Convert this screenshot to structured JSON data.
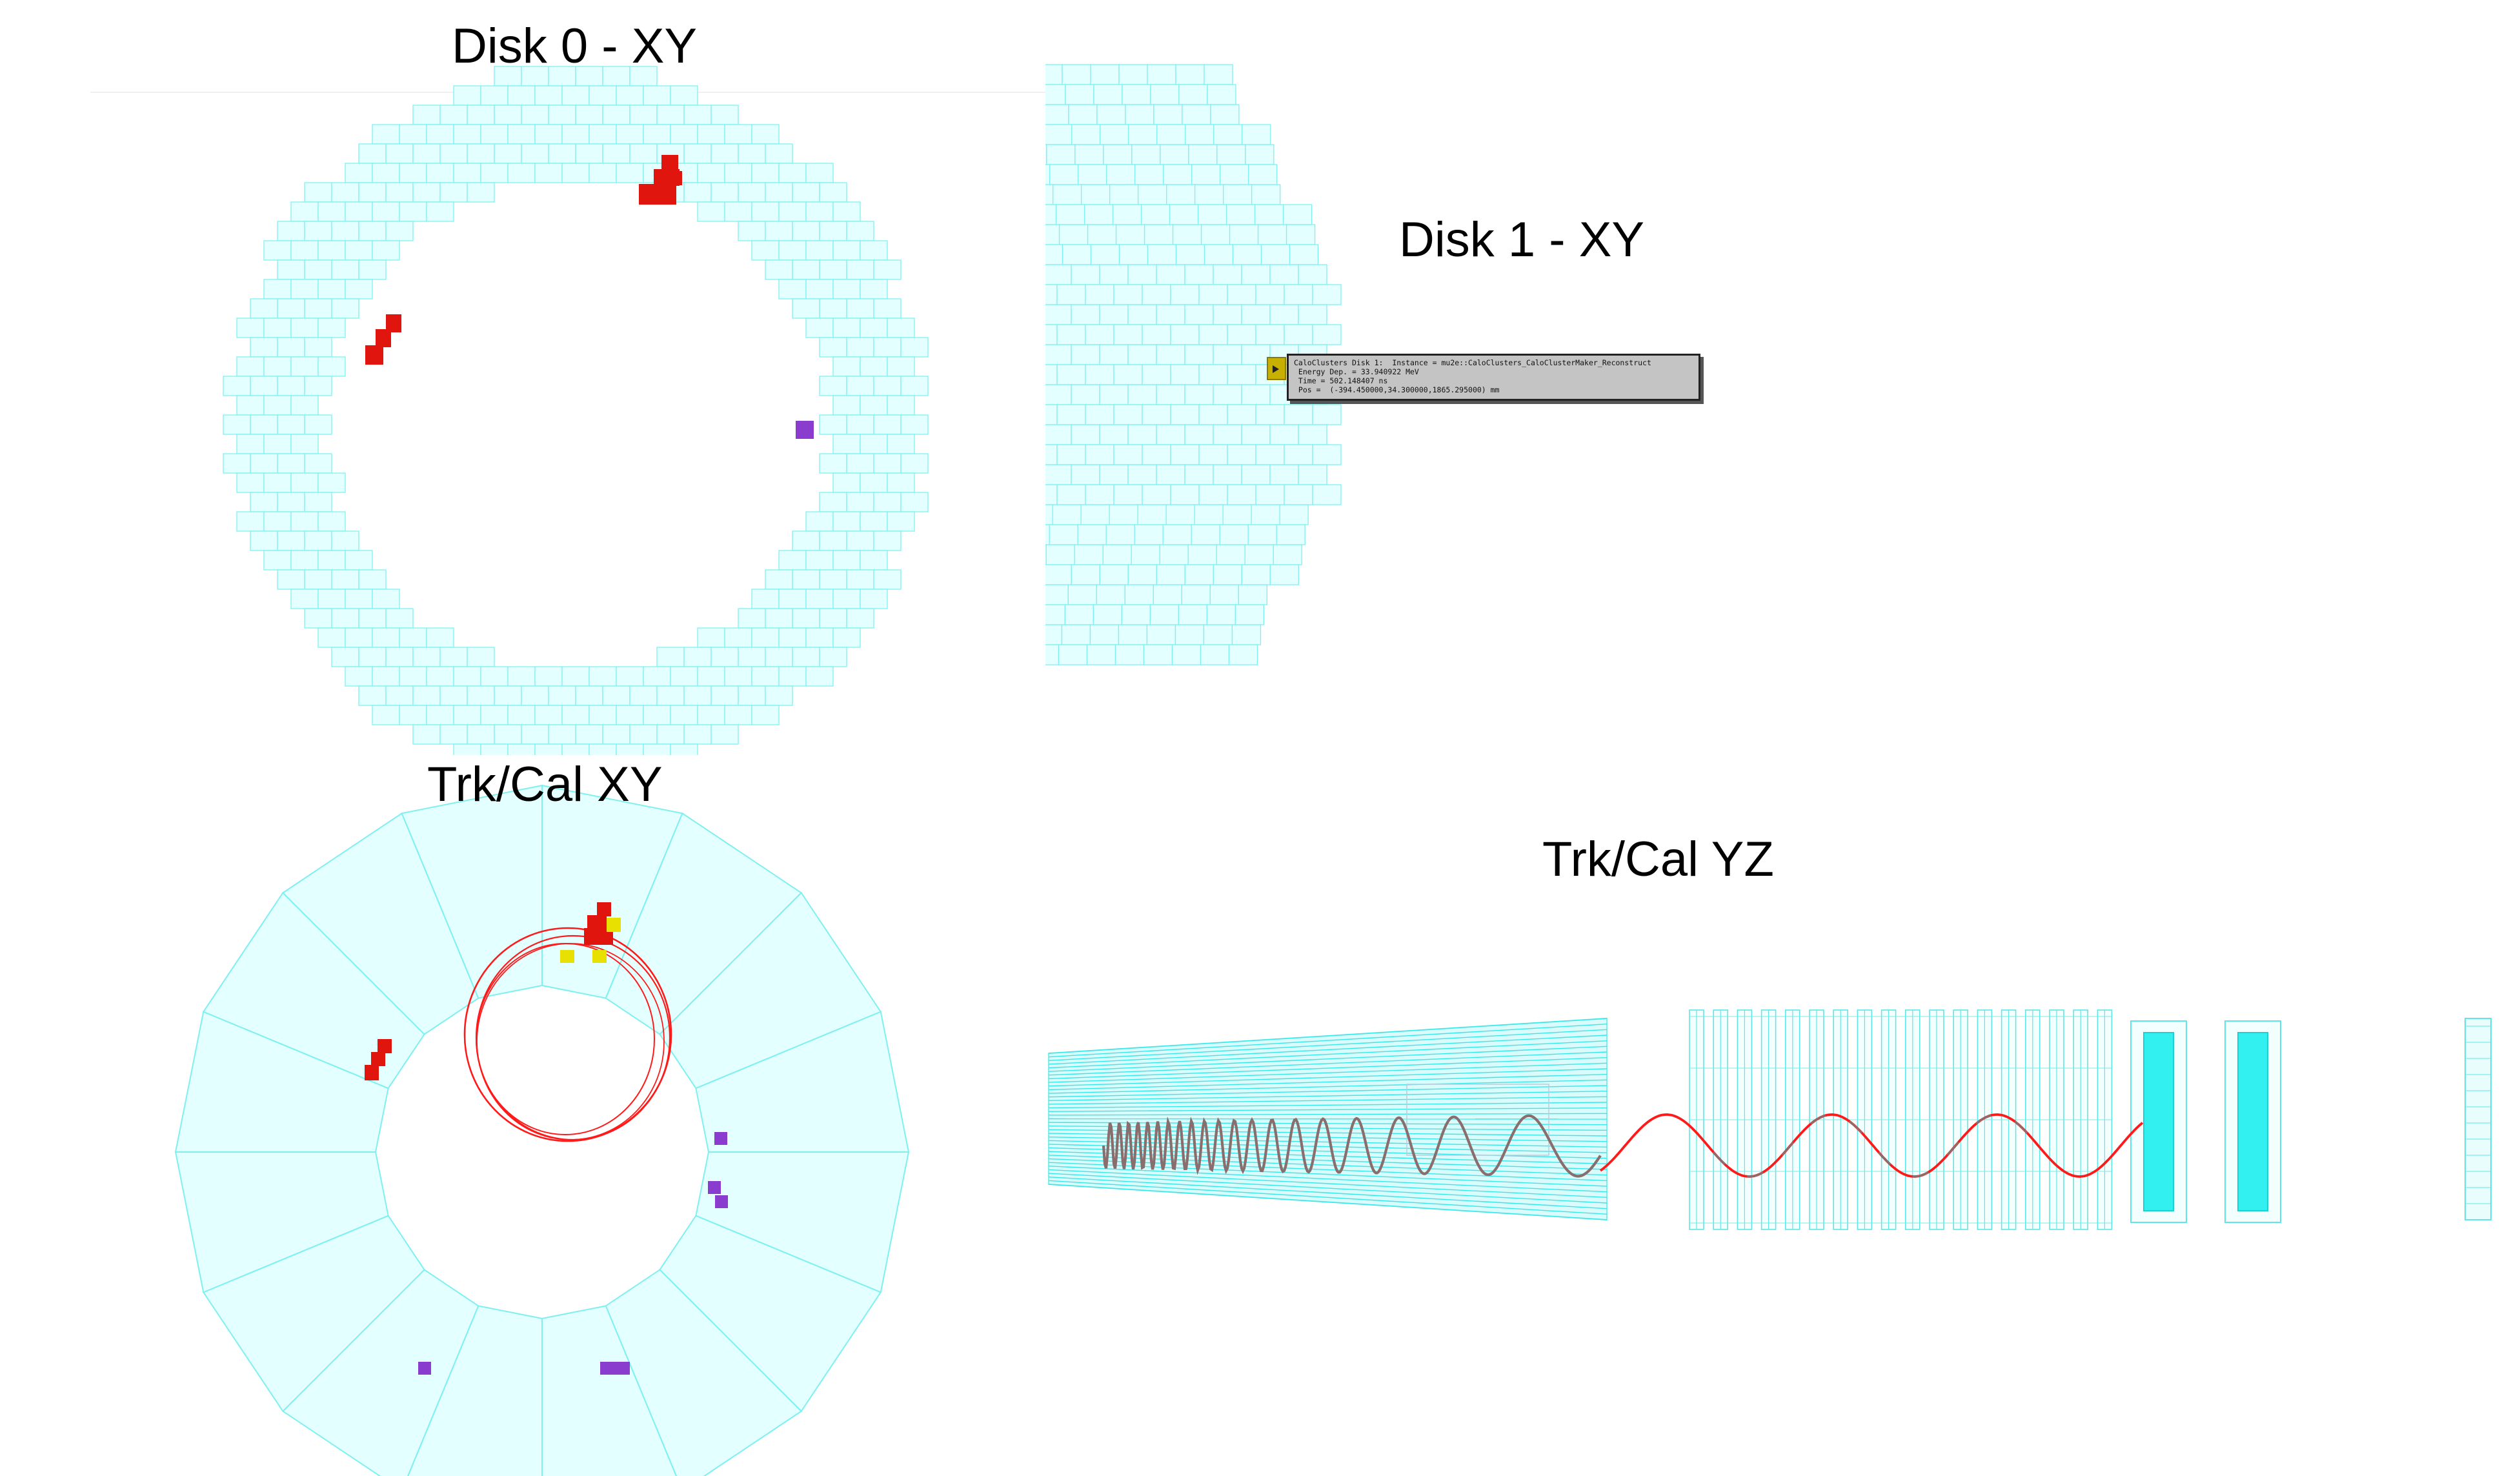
{
  "panels": {
    "disk0": {
      "title": "Disk 0 - XY"
    },
    "disk1": {
      "title": "Disk 1 - XY"
    },
    "trk_xy": {
      "title": "Trk/Cal XY"
    },
    "trk_yz": {
      "title": "Trk/Cal YZ"
    }
  },
  "tooltip": {
    "line1": "CaloClusters Disk 1:  Instance = mu2e::CaloClusters_CaloClusterMaker_Reconstruct",
    "line2": " Energy Dep. = 33.940922 MeV",
    "line3": " Time = 502.148407 ns",
    "line4": " Pos =  (-394.450000,34.300000,1865.295000) mm"
  },
  "colors": {
    "crystal_fill": "#e4ffff",
    "crystal_edge": "#7ff0f0",
    "hit_red": "#e0160e",
    "hit_purple": "#8a3ccf",
    "hit_yellow": "#e8e000",
    "track_red": "#ff1a1a",
    "helix_grey": "#8a6e6e",
    "dense_cyan": "#33f0f0"
  }
}
